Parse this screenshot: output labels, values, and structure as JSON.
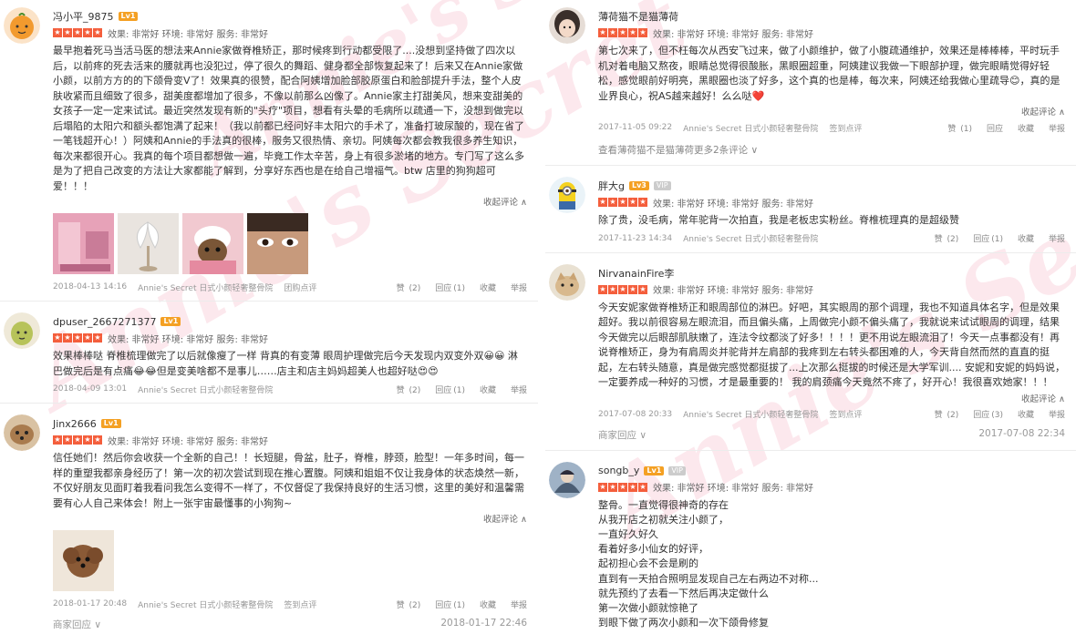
{
  "watermark_text": "Annie's Secret",
  "labels": {
    "collapse": "收起评论 ∧",
    "like": "赞",
    "reply": "回应",
    "fav": "收藏",
    "report": "举报",
    "merchant_reply": "商家回应 ∨"
  },
  "left_reviews": [
    {
      "username": "冯小平_9875",
      "level": "Lv1",
      "avatar_icon": "orange-face",
      "rating_text": "效果: 非常好   环境: 非常好   服务: 非常好",
      "text": "最早抱着死马当活马医的想法来Annie家做脊椎矫正，那时候疼到行动都受限了....没想到坚持做了四次以后，以前疼的死去活来的腰就再也没犯过，停了很久的舞蹈、健身都全部恢复起来了！后来又在Annie家做小颜，以前方方的的下颌骨变V了！效果真的很赞，配合阿姨增加脸部胶原蛋白和脸部提升手法，整个人皮肤收紧而且细致了很多，甜美度都增加了很多，不像以前那么凶像了。Annie家主打甜美风，想来变甜美的女孩子一定一定来试试。最近突然发现有新的\"头疗\"项目，想看有头晕的毛病所以疏通一下，没想到做完以后塌陷的太阳穴和额头都饱满了起来！（我以前都已经问好丰太阳穴的手术了，准备打玻尿酸的，现在省了一笔钱超开心！）阿姨和Annie的手法真的很棒，服务又很热情、亲切。阿姨每次都会教我很多养生知识，每次来都很开心。我真的每个项目都想做一遍，毕竟工作太辛苦，身上有很多淤堵的地方。专门写了这么多是为了把自己改变的方法让大家都能了解到，分享好东西也是在给自己增福气。btw 店里的狗狗超可爱！！！",
      "show_collapse": true,
      "photos": [
        "pink-room",
        "white-feather-lamp",
        "dog-in-pink-robe",
        "face-closeup"
      ],
      "date": "2018-04-13 14:16",
      "shop": "Annie's Secret 日式小颜轻奢整骨院",
      "extra": "团购点评",
      "like_count": "(2)",
      "reply_count": "(1)"
    },
    {
      "username": "dpuser_2667271377",
      "level": "Lv1",
      "avatar_icon": "pear-face",
      "rating_text": "效果: 非常好   环境: 非常好   服务: 非常好",
      "text": "效果棒棒哒 脊椎梳理做完了以后就像瘦了一样  背真的有变薄  眼周护理做完后今天发现内双变外双😀😀 淋巴做完后是有点痛😂😂但是变美啥都不是事儿……店主和店主妈妈超美人也超好哒😍😍",
      "show_collapse": false,
      "photos": [],
      "date": "2018-04-09 13:01",
      "shop": "Annie's Secret 日式小颜轻奢整骨院",
      "extra": "",
      "like_count": "(2)",
      "reply_count": "(1)"
    },
    {
      "username": "Jinx2666",
      "level": "Lv1",
      "avatar_icon": "dog-photo",
      "rating_text": "效果: 非常好   环境: 非常好   服务: 非常好",
      "text": "信任她们！然后你会收获一个全新的自己！！长短腿，骨盆，肚子，脊椎，脖颈，脸型！一年多时间，每一样的重塑我都亲身经历了！第一次的初次尝试到现在推心置腹。阿姨和姐姐不仅让我身体的状态焕然一新，不仅好朋友见面盯着我看问我怎么变得不一样了，不仅督促了我保持良好的生活习惯，这里的美好和温馨需要有心人自己来体会！附上一张宇宙最懂事的小狗狗~",
      "show_collapse": true,
      "photos": [
        "toy-poodle"
      ],
      "date": "2018-01-17 20:48",
      "shop": "Annie's Secret 日式小颜轻奢整骨院",
      "extra": "签到点评",
      "like_count": "(2)",
      "reply_count": "(1)",
      "merchant_reply": true,
      "merchant_date": "2018-01-17 22:46"
    }
  ],
  "right_reviews": [
    {
      "username": "薄荷猫不是猫薄荷",
      "level": "",
      "avatar_icon": "girl-photo",
      "rating_text": "效果: 非常好   环境: 非常好   服务: 非常好",
      "text": "第七次来了，但不枉每次从西安飞过来，做了小颜维护，做了小腹疏通维护，效果还是棒棒棒，平时玩手机对着电脑又熬夜，眼睛总觉得很酸胀，黑眼圈超重，阿姨建议我做一下眼部护理，做完眼睛觉得好轻松，感觉眼前好明亮，黑眼圈也淡了好多，这个真的也是棒，每次来，阿姨还给我做心里疏导😊，真的是业界良心，祝AS越来越好！么么哒❤️",
      "show_collapse": true,
      "date": "2017-11-05 09:22",
      "shop": "Annie's Secret 日式小颜轻奢整骨院",
      "extra": "签到点评",
      "like_count": "(1)",
      "reply_count": "",
      "more_line": "查看薄荷猫不是猫薄荷更多2条评论 ∨"
    },
    {
      "username": "胖大g",
      "level": "Lv3",
      "vip": true,
      "avatar_icon": "minion",
      "rating_text": "效果: 非常好   环境: 非常好   服务: 非常好",
      "text": "除了贵，没毛病，常年驼背一次拍直，我是老板忠实粉丝。脊椎梳理真的是超级赞",
      "show_collapse": false,
      "date": "2017-11-23 14:34",
      "shop": "Annie's Secret 日式小颜轻奢整骨院",
      "extra": "",
      "like_count": "(2)",
      "reply_count": "(1)"
    },
    {
      "username": "NirvanainFire李",
      "level": "",
      "avatar_icon": "cat-photo",
      "rating_text": "效果: 非常好   环境: 非常好   服务: 非常好",
      "text": "今天安妮家做脊椎矫正和眼周部位的淋巴。好吧，其实眼周的那个调理，我也不知道具体名字，但是效果超好。我以前很容易左眼流泪，而且偏头痛，上周做完小颜不偏头痛了，我就说来试试眼周的调理，结果今天做完以后眼部肌肤嫩了，连法令纹都淡了好多！！！！更不用说左眼流泪了！今天一点事都没有！再说脊椎矫正，身为有肩周炎并驼背并左肩部的我疼到左右转头都困难的人，今天背自然而然的直直的挺起，左右转头随意，真是做完感觉都挺拔了...上次那么挺拔的时候还是大学军训.... 安妮和安妮的妈妈说，一定要养成一种好的习惯，才是最重要的！ 我的肩颈痛今天竟然不疼了，好开心！我很喜欢她家！！！",
      "show_collapse": true,
      "date": "2017-07-08 20:33",
      "shop": "Annie's Secret 日式小颜轻奢整骨院",
      "extra": "签到点评",
      "like_count": "(2)",
      "reply_count": "(3)",
      "merchant_reply": true,
      "merchant_date": "2017-07-08 22:34"
    },
    {
      "username": "songb_y",
      "level": "Lv1",
      "vip": true,
      "avatar_icon": "cartoon-figure",
      "rating_text": "效果: 非常好   环境: 非常好   服务: 非常好",
      "lines": [
        "整骨。一直觉得很神奇的存在",
        "从我开店之初就关注小颜了，",
        "一直好久好久",
        "看着好多小仙女的好评，",
        "起初担心会不会是刷的",
        "直到有一天拍合照明显发现自己左右两边不对称...",
        "就先预约了去看一下然后再决定做什么",
        "第一次做小颜就惊艳了",
        "到眼下做了两次小颜和一次下颌骨修复"
      ]
    }
  ]
}
